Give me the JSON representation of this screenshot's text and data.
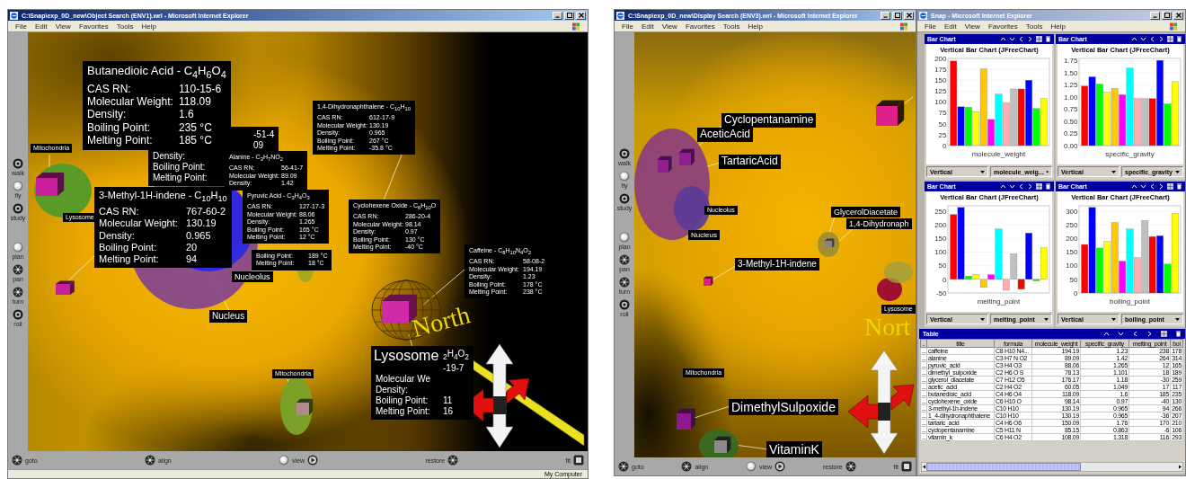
{
  "object_search_window": {
    "title": "C:\\Snap\\exp_0D_new\\Object Search (ENV1).wrl - Microsoft Internet Explorer",
    "menu": [
      "File",
      "Edit",
      "View",
      "Favorites",
      "Tools",
      "Help"
    ],
    "nav_toolbar": [
      "walk",
      "fly",
      "study",
      "plan",
      "pan",
      "turn",
      "roll"
    ],
    "info_cards": [
      {
        "title": "Butanedioic Acid - C$_{4}$H$_{6}$O$_{4}$",
        "rows": [
          {
            "label": "CAS RN:",
            "value": "110-15-6"
          },
          {
            "label": "Molecular Weight:",
            "value": "118.09"
          },
          {
            "label": "Density:",
            "value": "1.6"
          },
          {
            "label": "Boiling Point:",
            "value": "235 °C"
          },
          {
            "label": "Melting Point:",
            "value": "185 °C"
          }
        ]
      },
      {
        "rows": [
          {
            "value": "-51-4"
          },
          {
            "value": "09"
          },
          {
            "label": "Density:"
          },
          {
            "label": "Boiling Point:"
          },
          {
            "label": "Melting Point:"
          }
        ]
      },
      {
        "title": "1,4-Dihydronaphthalene - C$_{10}$H$_{10}$",
        "rows": [
          {
            "label": "CAS RN:",
            "value": "612-17-9"
          },
          {
            "label": "Molecular Weight:",
            "value": "130.19"
          },
          {
            "label": "Density:",
            "value": "0.965"
          },
          {
            "label": "Boiling Point:",
            "value": "267 °C"
          },
          {
            "label": "Melting Point:",
            "value": "-35.8 °C"
          }
        ]
      },
      {
        "title": "3-Methyl-1H-indene - C$_{10}$H$_{10}$",
        "rows": [
          {
            "label": "CAS RN:",
            "value": "767-60-2"
          },
          {
            "label": "Molecular Weight:",
            "value": "130.19"
          },
          {
            "label": "Density:",
            "value": "0.965"
          },
          {
            "label": "Boiling Point:",
            "value": "20"
          },
          {
            "label": "Melting Point:",
            "value": "94"
          }
        ]
      },
      {
        "title": "Alanine - C$_{3}$H$_{7}$NO$_{2}$",
        "rows": [
          {
            "label": "CAS RN:",
            "value": "56-41-7"
          },
          {
            "label": "Molecular Weight:",
            "value": "89.09"
          },
          {
            "label": "Density:",
            "value": "1.42"
          }
        ]
      },
      {
        "title": "Pyruvic Acid - C$_{3}$H$_{4}$O$_{3}$",
        "rows": [
          {
            "label": "CAS RN:",
            "value": "127-17-3"
          },
          {
            "label": "Molecular Weight:",
            "value": "88.06"
          },
          {
            "label": "Density:",
            "value": "1.265"
          },
          {
            "label": "Boiling Point:",
            "value": "165 °C"
          },
          {
            "label": "Melting Point:",
            "value": "12 °C"
          }
        ]
      },
      {
        "title": "Cyclohexene Oxide - C$_{6}$H$_{10}$O",
        "rows": [
          {
            "label": "CAS RN:",
            "value": "286-20-4"
          },
          {
            "label": "Molecular Weight:",
            "value": "98.14"
          },
          {
            "label": "Density:",
            "value": "0.97"
          },
          {
            "label": "Boiling Point:",
            "value": "130 °C"
          },
          {
            "label": "Melting Point:",
            "value": "-40 °C"
          }
        ]
      },
      {
        "rows": [
          {
            "label": "Boiling Point:",
            "value": "189 °C"
          },
          {
            "label": "Melting Point:",
            "value": "18 °C"
          }
        ]
      },
      {
        "title": "Caffeine - C$_{8}$H$_{10}$N$_{4}$O$_{2}$",
        "rows": [
          {
            "label": "CAS RN:",
            "value": "58-08-2"
          },
          {
            "label": "Molecular Weight:",
            "value": "194.19"
          },
          {
            "label": "Density:",
            "value": "1.23"
          },
          {
            "label": "Boiling Point:",
            "value": "178 °C"
          },
          {
            "label": "Melting Point:",
            "value": "238 °C"
          }
        ]
      },
      {
        "title": "$_{2}$H$_{4}$O$_{2}$",
        "rows": [
          {
            "value": "-19-7"
          },
          {
            "label": "Molecular We"
          },
          {
            "label": "Density:"
          },
          {
            "label": "Boiling Point:",
            "value": "11"
          },
          {
            "label": "Melting Point:",
            "value": "16"
          }
        ]
      }
    ],
    "labels": [
      "Mitochondria",
      "Lysosome",
      "Nucleolus",
      "Nucleus",
      "Mitochondria",
      "Lysosome"
    ],
    "compass_label": "North",
    "bottom_toolbar": [
      "goto",
      "align",
      "view",
      "restore",
      "fit"
    ],
    "status_bar": {
      "zone": "My Computer"
    }
  },
  "display_search_window": {
    "title": "C:\\Snap\\exp_0D_new\\Display Search (ENV3).wrl - Microsoft Internet Explorer",
    "menu": [
      "File",
      "Edit",
      "View",
      "Favorites",
      "Tools",
      "Help"
    ],
    "nav_toolbar": [
      "walk",
      "fly",
      "study",
      "plan",
      "pan",
      "turn",
      "roll"
    ],
    "labels": [
      "Cyclopentanamine",
      "AceticAcid",
      "TartaricAcid",
      "Nucleolus",
      "Nucleus",
      "3-Methyl-1H-indene",
      "GlycerolDiacetate",
      "1,4-Dihydronaph",
      "Lysosome",
      "Mitochondria",
      "DimethylSulpoxide",
      "VitaminK"
    ],
    "compass_label": "Nort",
    "bottom_toolbar": [
      "goto",
      "align",
      "view",
      "restore",
      "fit"
    ]
  },
  "snap_window": {
    "title": "Snap - Microsoft Internet Explorer",
    "menu": [
      "File",
      "Edit",
      "View",
      "Favorites",
      "Tools",
      "Help"
    ],
    "charts": [
      {
        "panel_title": "Bar Chart",
        "dropdowns": [
          "Vertical",
          "molecule_weig..."
        ],
        "chart_data": {
          "type": "bar",
          "title": "Vertical Bar Chart (JFreeChart)",
          "xlabel": "molecule_weight",
          "grid": true,
          "ylim": [
            0,
            200
          ],
          "yticks": [
            0,
            25,
            50,
            75,
            100,
            125,
            150,
            175,
            200
          ],
          "series": [
            {
              "color": "#ff0000",
              "values": [
                194
              ]
            },
            {
              "color": "#0000ff",
              "values": [
                89
              ]
            },
            {
              "color": "#00ff00",
              "values": [
                88
              ]
            },
            {
              "color": "#ffff00",
              "values": [
                78
              ]
            },
            {
              "color": "#ffc800",
              "values": [
                176
              ]
            },
            {
              "color": "#ff00ff",
              "values": [
                60
              ]
            },
            {
              "color": "#00ffff",
              "values": [
                118
              ]
            },
            {
              "color": "#ffafaf",
              "values": [
                98
              ]
            },
            {
              "color": "#c0c0c0",
              "values": [
                130
              ]
            },
            {
              "color": "#ff0000",
              "values": [
                130
              ]
            },
            {
              "color": "#0000ff",
              "values": [
                150
              ]
            },
            {
              "color": "#00ff00",
              "values": [
                85
              ]
            },
            {
              "color": "#ffff00",
              "values": [
                108
              ]
            }
          ]
        }
      },
      {
        "panel_title": "Bar Chart",
        "dropdowns": [
          "Vertical",
          "specific_gravity"
        ],
        "chart_data": {
          "type": "bar",
          "title": "Vertical Bar Chart (JFreeChart)",
          "xlabel": "specific_gravity",
          "grid": true,
          "ylim": [
            0,
            1.8
          ],
          "yticks": [
            {
              "value": 0,
              "label": "0.00"
            },
            {
              "value": 0.25,
              "label": "0.25"
            },
            {
              "value": 0.5,
              "label": "0.50"
            },
            {
              "value": 0.75,
              "label": "0.75"
            },
            {
              "value": 1,
              "label": "1.00"
            },
            {
              "value": 1.25,
              "label": "1.25"
            },
            {
              "value": 1.5,
              "label": "1.50"
            },
            {
              "value": 1.75,
              "label": "1.75"
            }
          ],
          "series": [
            {
              "color": "#ff0000",
              "values": [
                1.23
              ]
            },
            {
              "color": "#0000ff",
              "values": [
                1.42
              ]
            },
            {
              "color": "#00ff00",
              "values": [
                1.27
              ]
            },
            {
              "color": "#ffff00",
              "values": [
                1.1
              ]
            },
            {
              "color": "#ffc800",
              "values": [
                1.18
              ]
            },
            {
              "color": "#ff00ff",
              "values": [
                1.05
              ]
            },
            {
              "color": "#00ffff",
              "values": [
                1.6
              ]
            },
            {
              "color": "#ffafaf",
              "values": [
                0.97
              ]
            },
            {
              "color": "#c0c0c0",
              "values": [
                0.97
              ]
            },
            {
              "color": "#ff0000",
              "values": [
                0.97
              ]
            },
            {
              "color": "#0000ff",
              "values": [
                1.76
              ]
            },
            {
              "color": "#00ff00",
              "values": [
                0.86
              ]
            },
            {
              "color": "#ffff00",
              "values": [
                1.32
              ]
            }
          ]
        }
      },
      {
        "panel_title": "Bar Chart",
        "dropdowns": [
          "Vertical",
          "melting_point"
        ],
        "chart_data": {
          "type": "bar",
          "title": "Vertical Bar Chart (JFreeChart)",
          "xlabel": "melting_point",
          "grid": true,
          "ylim": [
            -50,
            270
          ],
          "yticks": [
            -50,
            0,
            50,
            100,
            150,
            200,
            250
          ],
          "series": [
            {
              "color": "#ff0000",
              "values": [
                238
              ]
            },
            {
              "color": "#0000ff",
              "values": [
                264
              ]
            },
            {
              "color": "#00ff00",
              "values": [
                12
              ]
            },
            {
              "color": "#ffff00",
              "values": [
                18
              ]
            },
            {
              "color": "#ffc800",
              "values": [
                -30
              ]
            },
            {
              "color": "#ff00ff",
              "values": [
                17
              ]
            },
            {
              "color": "#00ffff",
              "values": [
                185
              ]
            },
            {
              "color": "#ffafaf",
              "values": [
                -40
              ]
            },
            {
              "color": "#c0c0c0",
              "values": [
                94
              ]
            },
            {
              "color": "#ff0000",
              "values": [
                -36
              ]
            },
            {
              "color": "#0000ff",
              "values": [
                170
              ]
            },
            {
              "color": "#00ff00",
              "values": [
                -6
              ]
            },
            {
              "color": "#ffff00",
              "values": [
                116
              ]
            }
          ]
        }
      },
      {
        "panel_title": "Bar Chart",
        "dropdowns": [
          "Vertical",
          "boiling_point"
        ],
        "chart_data": {
          "type": "bar",
          "title": "Vertical Bar Chart (JFreeChart)",
          "xlabel": "boiling_point",
          "grid": true,
          "ylim": [
            0,
            320
          ],
          "yticks": [
            0,
            50,
            100,
            150,
            200,
            250,
            300
          ],
          "series": [
            {
              "color": "#ff0000",
              "values": [
                178
              ]
            },
            {
              "color": "#0000ff",
              "values": [
                314
              ]
            },
            {
              "color": "#00ff00",
              "values": [
                165
              ]
            },
            {
              "color": "#ffff00",
              "values": [
                189
              ]
            },
            {
              "color": "#ffc800",
              "values": [
                259
              ]
            },
            {
              "color": "#ff00ff",
              "values": [
                117
              ]
            },
            {
              "color": "#00ffff",
              "values": [
                235
              ]
            },
            {
              "color": "#ffafaf",
              "values": [
                130
              ]
            },
            {
              "color": "#c0c0c0",
              "values": [
                266
              ]
            },
            {
              "color": "#ff0000",
              "values": [
                207
              ]
            },
            {
              "color": "#0000ff",
              "values": [
                210
              ]
            },
            {
              "color": "#00ff00",
              "values": [
                106
              ]
            },
            {
              "color": "#ffff00",
              "values": [
                293
              ]
            }
          ]
        }
      }
    ],
    "table": {
      "panel_title": "Table",
      "columns": [
        "..",
        "title",
        "formula",
        "molecule_weight",
        "specific_gravity",
        "melting_point",
        "boi"
      ],
      "rows": [
        [
          "...",
          "caffeine",
          "C8 H10 N4...",
          "194.19",
          "1.23",
          "238",
          "178"
        ],
        [
          "...",
          "alanine",
          "C3 H7 N O2",
          "89.09",
          "1.42",
          "264",
          "314"
        ],
        [
          "...",
          "pyruvic_acid",
          "C3 H4 O3",
          "88.06",
          "1.265",
          "12",
          "165"
        ],
        [
          "...",
          "dimethyl_sulpoxide",
          "C2 H6 O S",
          "78.13",
          "1.101",
          "18",
          "189"
        ],
        [
          "...",
          "glycerol_diacetate",
          "C7 H12 O5",
          "176.17",
          "1.18",
          "-30",
          "259"
        ],
        [
          "...",
          "acetic_acid",
          "C2 H4 O2",
          "60.05",
          "1.049",
          "17",
          "117"
        ],
        [
          "...",
          "butanedioic_acid",
          "C4 H6 O4",
          "118.09",
          "1.6",
          "185",
          "235"
        ],
        [
          "...",
          "cyclohexene_oxide",
          "C6 H10 O",
          "98.14",
          "0.97",
          "-40",
          "130"
        ],
        [
          "...",
          "3-methyl-1h-indene",
          "C10 H10",
          "130.19",
          "0.965",
          "94",
          "266"
        ],
        [
          "...",
          "1_4-dihydronaphthalene",
          "C10 H10",
          "130.19",
          "0.965",
          "-36",
          "207"
        ],
        [
          "...",
          "tartaric_acid",
          "C4 H6 O6",
          "150.09",
          "1.76",
          "170",
          "210"
        ],
        [
          "...",
          "cyclopentanamine",
          "C5 H11 N",
          "85.15",
          "0.863",
          "-6",
          "106"
        ],
        [
          "...",
          "vitamin_k",
          "C6 H4 O2",
          "108.09",
          "1.318",
          "116",
          "293"
        ]
      ]
    }
  }
}
